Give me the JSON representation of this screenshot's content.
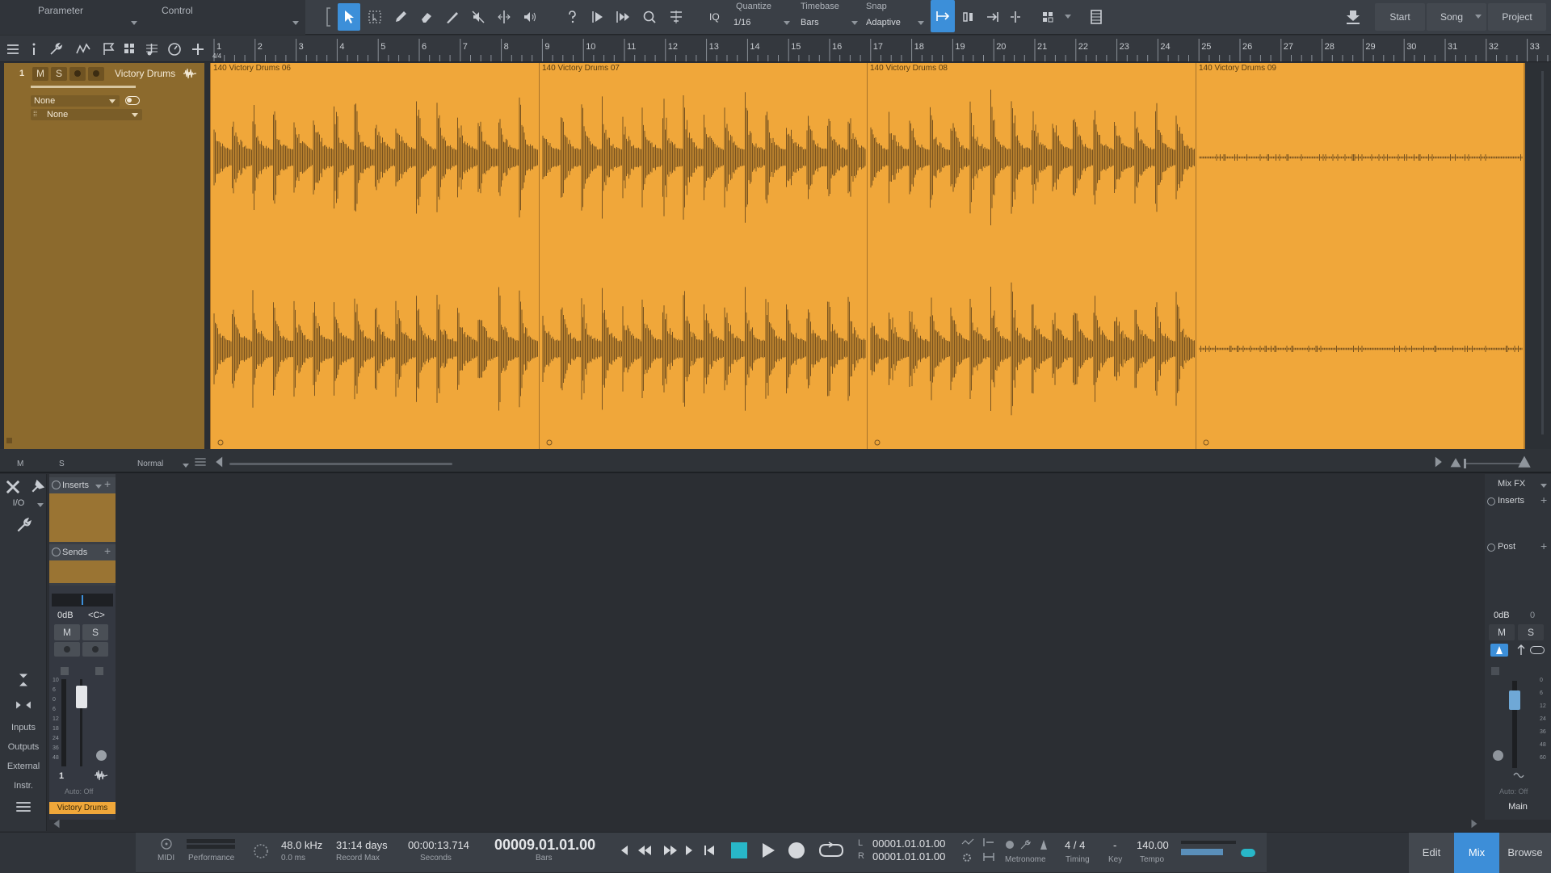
{
  "toolbar": {
    "parameter_label": "Parameter",
    "control_label": "Control",
    "iq_label": "IQ",
    "quantize_label": "Quantize",
    "quantize_value": "1/16",
    "timebase_label": "Timebase",
    "timebase_value": "Bars",
    "snap_label": "Snap",
    "snap_value": "Adaptive",
    "start_label": "Start",
    "song_label": "Song",
    "project_label": "Project",
    "accent_color": "#3c8fd9"
  },
  "ruler": {
    "time_signature": "4/4",
    "bars": [
      "1",
      "2",
      "3",
      "4",
      "5",
      "6",
      "7",
      "8",
      "9",
      "10",
      "11",
      "12",
      "13",
      "14",
      "15",
      "16",
      "17",
      "18",
      "19",
      "20",
      "21",
      "22",
      "23",
      "24",
      "25",
      "26",
      "27",
      "28",
      "29",
      "30",
      "31",
      "32",
      "33"
    ]
  },
  "track": {
    "number": "1",
    "mute_label": "M",
    "solo_label": "S",
    "name": "Victory Drums",
    "input_value": "None",
    "output_value": "None",
    "color": "#f0a73a",
    "events": [
      {
        "name": "140 Victory Drums 06"
      },
      {
        "name": "140 Victory Drums 07"
      },
      {
        "name": "140 Victory Drums 08"
      },
      {
        "name": "140 Victory Drums 09"
      }
    ]
  },
  "arrange_bottom": {
    "m_label": "M",
    "s_label": "S",
    "mode_value": "Normal"
  },
  "mixer": {
    "io_label": "I/O",
    "inserts_label": "Inserts",
    "sends_label": "Sends",
    "volume_value": "0dB",
    "pan_value": "<C>",
    "mute_label": "M",
    "solo_label": "S",
    "channel_number": "1",
    "auto_label": "Auto: Off",
    "channel_name": "Victory Drums",
    "nav": {
      "inputs": "Inputs",
      "outputs": "Outputs",
      "external": "External",
      "instr": "Instr."
    },
    "meter_scale": [
      "10",
      "6",
      "0",
      "6",
      "12",
      "18",
      "24",
      "36",
      "48"
    ],
    "main": {
      "mixfx_label": "Mix FX",
      "inserts_label": "Inserts",
      "post_label": "Post",
      "volume_value": "0dB",
      "pan_value": "0",
      "mute_label": "M",
      "solo_label": "S",
      "auto_label": "Auto: Off",
      "name": "Main",
      "meter_scale": [
        "0",
        "6",
        "12",
        "24",
        "36",
        "48",
        "60"
      ]
    }
  },
  "transport": {
    "midi_label": "MIDI",
    "performance_label": "Performance",
    "sample_rate": "48.0 kHz",
    "latency": "0.0 ms",
    "record_max_value": "31:14 days",
    "record_max_label": "Record Max",
    "seconds_value": "00:00:13.714",
    "seconds_label": "Seconds",
    "bars_value": "00009.01.01.00",
    "bars_label": "Bars",
    "loop_left_prefix": "L",
    "loop_left": "00001.01.01.00",
    "loop_right_prefix": "R",
    "loop_right": "00001.01.01.00",
    "metronome_label": "Metronome",
    "timing_value": "4 / 4",
    "timing_label": "Timing",
    "key_value": "-",
    "key_label": "Key",
    "tempo_value": "140.00",
    "tempo_label": "Tempo",
    "edit_label": "Edit",
    "mix_label": "Mix",
    "browse_label": "Browse"
  }
}
